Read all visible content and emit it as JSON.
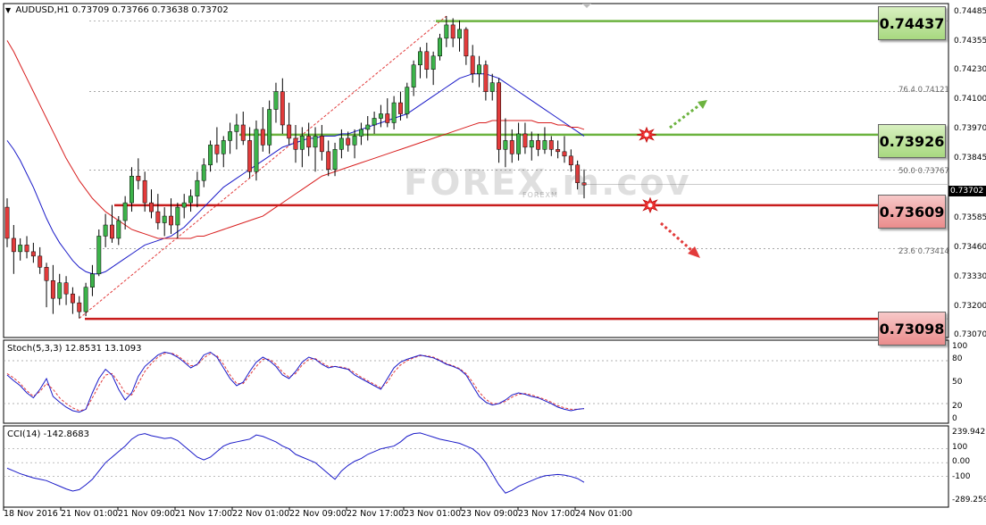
{
  "header": {
    "symbol": "AUDUSD,H1",
    "ohlc": "0.73709 0.73766 0.73638 0.73702"
  },
  "watermark": {
    "text": "FOREX.m.cov",
    "sub": "FOREXM"
  },
  "colors": {
    "bull": "#3cb34a",
    "bear": "#e23b3b",
    "ma_fast": "#1a1ac8",
    "ma_slow": "#d81e1e",
    "resistance": "#6cb33f",
    "support": "#c81c1c",
    "oscillator": "#1a1ac8",
    "signal": "#e23b3b"
  },
  "price_axis": {
    "labels": [
      "0.74485",
      "0.74355",
      "0.74230",
      "0.74100",
      "0.73970",
      "0.73845",
      "0.73715",
      "0.73585",
      "0.73460",
      "0.73330",
      "0.73200",
      "0.73070"
    ],
    "current": "0.73702"
  },
  "levels": {
    "r2": "0.74437",
    "r1": "0.73926",
    "s1": "0.73609",
    "s2": "0.73098"
  },
  "fib_labels": {
    "f764": "76.4  0.74121",
    "f500": "50.0  0.73767",
    "f236": "23.6  0.73414"
  },
  "x_labels": [
    "18 Nov 2016",
    "21 Nov 01:00",
    "21 Nov 09:00",
    "21 Nov 17:00",
    "22 Nov 01:00",
    "22 Nov 09:00",
    "22 Nov 17:00",
    "23 Nov 01:00",
    "23 Nov 09:00",
    "23 Nov 17:00",
    "24 Nov 01:00"
  ],
  "stoch": {
    "label": "Stoch(5,3,3) 12.8531 13.1093",
    "axis": [
      "100",
      "80",
      "50",
      "20",
      "0"
    ]
  },
  "cci": {
    "label": "CCI(14) -142.8683",
    "axis": [
      "239.9421",
      "100",
      "0.00",
      "-100",
      "-289.259"
    ]
  },
  "chart_data": [
    {
      "type": "candlestick",
      "title": "AUDUSD,H1",
      "timeframe": "H1",
      "y_range": [
        0.7303,
        0.745
      ],
      "current_price": 0.73702,
      "candles": [
        [
          0.736,
          0.7364,
          0.7342,
          0.7346
        ],
        [
          0.7346,
          0.7352,
          0.733,
          0.734
        ],
        [
          0.734,
          0.7346,
          0.7336,
          0.7343
        ],
        [
          0.7343,
          0.7347,
          0.7337,
          0.734
        ],
        [
          0.734,
          0.7344,
          0.7335,
          0.7338
        ],
        [
          0.7338,
          0.7342,
          0.733,
          0.7333
        ],
        [
          0.7333,
          0.7335,
          0.7315,
          0.7327
        ],
        [
          0.7327,
          0.7334,
          0.7312,
          0.7319
        ],
        [
          0.7319,
          0.733,
          0.7316,
          0.7326
        ],
        [
          0.7326,
          0.7329,
          0.7316,
          0.7321
        ],
        [
          0.7321,
          0.7324,
          0.7312,
          0.7317
        ],
        [
          0.7317,
          0.732,
          0.731,
          0.7313
        ],
        [
          0.7313,
          0.7326,
          0.7311,
          0.7324
        ],
        [
          0.7324,
          0.7334,
          0.732,
          0.733
        ],
        [
          0.733,
          0.735,
          0.7329,
          0.7347
        ],
        [
          0.7347,
          0.7357,
          0.7342,
          0.7352
        ],
        [
          0.7352,
          0.7361,
          0.7344,
          0.7346
        ],
        [
          0.7346,
          0.7356,
          0.7343,
          0.7354
        ],
        [
          0.7354,
          0.7365,
          0.735,
          0.7362
        ],
        [
          0.7362,
          0.7378,
          0.7358,
          0.7374
        ],
        [
          0.7374,
          0.7382,
          0.7368,
          0.7372
        ],
        [
          0.7372,
          0.7376,
          0.7358,
          0.7362
        ],
        [
          0.7362,
          0.7368,
          0.7355,
          0.7358
        ],
        [
          0.7358,
          0.7366,
          0.735,
          0.7353
        ],
        [
          0.7353,
          0.736,
          0.7347,
          0.7356
        ],
        [
          0.7356,
          0.7364,
          0.7348,
          0.7352
        ],
        [
          0.7352,
          0.7362,
          0.7346,
          0.736
        ],
        [
          0.736,
          0.7366,
          0.7355,
          0.7362
        ],
        [
          0.7362,
          0.7368,
          0.7358,
          0.7365
        ],
        [
          0.7365,
          0.7376,
          0.736,
          0.7372
        ],
        [
          0.7372,
          0.7382,
          0.7369,
          0.7379
        ],
        [
          0.7379,
          0.739,
          0.7376,
          0.7388
        ],
        [
          0.7388,
          0.7396,
          0.738,
          0.7384
        ],
        [
          0.7384,
          0.7392,
          0.7378,
          0.739
        ],
        [
          0.739,
          0.7398,
          0.7384,
          0.7394
        ],
        [
          0.7394,
          0.7402,
          0.7386,
          0.7397
        ],
        [
          0.7397,
          0.7403,
          0.7388,
          0.739
        ],
        [
          0.739,
          0.7396,
          0.7373,
          0.7376
        ],
        [
          0.7376,
          0.7399,
          0.7372,
          0.7395
        ],
        [
          0.7395,
          0.7405,
          0.7385,
          0.7388
        ],
        [
          0.7388,
          0.7408,
          0.7384,
          0.7404
        ],
        [
          0.7404,
          0.7416,
          0.7398,
          0.7412
        ],
        [
          0.7412,
          0.7418,
          0.7393,
          0.7397
        ],
        [
          0.7397,
          0.7407,
          0.7388,
          0.7391
        ],
        [
          0.7391,
          0.7397,
          0.738,
          0.7386
        ],
        [
          0.7386,
          0.7396,
          0.7378,
          0.7392
        ],
        [
          0.7392,
          0.7398,
          0.7383,
          0.7387
        ],
        [
          0.7387,
          0.7396,
          0.7376,
          0.7392
        ],
        [
          0.7392,
          0.7397,
          0.7381,
          0.7385
        ],
        [
          0.7385,
          0.739,
          0.7374,
          0.7377
        ],
        [
          0.7377,
          0.7389,
          0.7374,
          0.7386
        ],
        [
          0.7386,
          0.7395,
          0.7382,
          0.7391
        ],
        [
          0.7391,
          0.7394,
          0.7385,
          0.7388
        ],
        [
          0.7388,
          0.7395,
          0.7382,
          0.7392
        ],
        [
          0.7392,
          0.7398,
          0.7388,
          0.7395
        ],
        [
          0.7395,
          0.7401,
          0.739,
          0.7397
        ],
        [
          0.7397,
          0.7403,
          0.7393,
          0.74
        ],
        [
          0.74,
          0.7406,
          0.7396,
          0.7402
        ],
        [
          0.7402,
          0.7409,
          0.7396,
          0.7398
        ],
        [
          0.7398,
          0.741,
          0.7395,
          0.7407
        ],
        [
          0.7407,
          0.7412,
          0.7399,
          0.7402
        ],
        [
          0.7402,
          0.7416,
          0.74,
          0.7414
        ],
        [
          0.7414,
          0.7426,
          0.741,
          0.7424
        ],
        [
          0.7424,
          0.7432,
          0.7418,
          0.743
        ],
        [
          0.743,
          0.7434,
          0.7418,
          0.7422
        ],
        [
          0.7422,
          0.743,
          0.7415,
          0.7428
        ],
        [
          0.7428,
          0.7438,
          0.7426,
          0.7436
        ],
        [
          0.7436,
          0.7446,
          0.7432,
          0.7442
        ],
        [
          0.7442,
          0.7445,
          0.7432,
          0.7436
        ],
        [
          0.7436,
          0.7444,
          0.743,
          0.744
        ],
        [
          0.744,
          0.7441,
          0.7424,
          0.7428
        ],
        [
          0.7428,
          0.7433,
          0.7416,
          0.742
        ],
        [
          0.742,
          0.7428,
          0.7414,
          0.7424
        ],
        [
          0.7424,
          0.7426,
          0.7408,
          0.7412
        ],
        [
          0.7412,
          0.742,
          0.7408,
          0.7416
        ],
        [
          0.7416,
          0.7418,
          0.738,
          0.7386
        ],
        [
          0.7386,
          0.74,
          0.7378,
          0.739
        ],
        [
          0.739,
          0.7395,
          0.738,
          0.7384
        ],
        [
          0.7384,
          0.7398,
          0.7381,
          0.7393
        ],
        [
          0.7393,
          0.7398,
          0.7384,
          0.7387
        ],
        [
          0.7387,
          0.7394,
          0.7381,
          0.739
        ],
        [
          0.739,
          0.7393,
          0.7383,
          0.7386
        ],
        [
          0.7386,
          0.7396,
          0.7384,
          0.739
        ],
        [
          0.739,
          0.7392,
          0.7383,
          0.7386
        ],
        [
          0.7386,
          0.739,
          0.7382,
          0.7385
        ],
        [
          0.7385,
          0.7392,
          0.738,
          0.7383
        ],
        [
          0.7383,
          0.7386,
          0.7376,
          0.7379
        ],
        [
          0.7379,
          0.7381,
          0.7368,
          0.7371
        ],
        [
          0.7371,
          0.7377,
          0.7364,
          0.737
        ]
      ],
      "ma_blue": [
        0.739,
        0.7386,
        0.7381,
        0.7375,
        0.7369,
        0.7362,
        0.7355,
        0.7349,
        0.7344,
        0.734,
        0.7336,
        0.7333,
        0.7331,
        0.733,
        0.733,
        0.7331,
        0.7333,
        0.7335,
        0.7337,
        0.7339,
        0.7341,
        0.7343,
        0.7344,
        0.7345,
        0.7346,
        0.7347,
        0.7349,
        0.7351,
        0.7354,
        0.7357,
        0.736,
        0.7363,
        0.7366,
        0.7369,
        0.7371,
        0.7373,
        0.7375,
        0.7377,
        0.7379,
        0.7381,
        0.7383,
        0.7385,
        0.7387,
        0.7388,
        0.7389,
        0.739,
        0.7391,
        0.7391,
        0.7392,
        0.7392,
        0.7392,
        0.7393,
        0.7393,
        0.7394,
        0.7395,
        0.7396,
        0.7397,
        0.7398,
        0.7399,
        0.74,
        0.7401,
        0.7402,
        0.7404,
        0.7406,
        0.7408,
        0.741,
        0.7412,
        0.7414,
        0.7416,
        0.7418,
        0.7419,
        0.742,
        0.742,
        0.742,
        0.7419,
        0.7418,
        0.7416,
        0.7414,
        0.7412,
        0.741,
        0.7408,
        0.7406,
        0.7404,
        0.7402,
        0.74,
        0.7398,
        0.7396,
        0.7394,
        0.7392
      ],
      "ma_red": [
        0.7435,
        0.743,
        0.7424,
        0.7418,
        0.7412,
        0.7406,
        0.74,
        0.7394,
        0.7388,
        0.7382,
        0.7377,
        0.7372,
        0.7368,
        0.7364,
        0.7361,
        0.7358,
        0.7356,
        0.7354,
        0.7352,
        0.735,
        0.7349,
        0.7348,
        0.7347,
        0.7346,
        0.7346,
        0.7346,
        0.7346,
        0.7346,
        0.7346,
        0.7347,
        0.7347,
        0.7348,
        0.7349,
        0.735,
        0.7351,
        0.7352,
        0.7353,
        0.7354,
        0.7355,
        0.7356,
        0.7358,
        0.736,
        0.7362,
        0.7364,
        0.7366,
        0.7368,
        0.737,
        0.7372,
        0.7374,
        0.7375,
        0.7376,
        0.7377,
        0.7378,
        0.7379,
        0.738,
        0.7381,
        0.7382,
        0.7383,
        0.7384,
        0.7385,
        0.7386,
        0.7387,
        0.7388,
        0.7389,
        0.739,
        0.7391,
        0.7392,
        0.7393,
        0.7394,
        0.7395,
        0.7396,
        0.7397,
        0.7398,
        0.7398,
        0.7399,
        0.7399,
        0.7399,
        0.7399,
        0.7399,
        0.7399,
        0.7399,
        0.7398,
        0.7398,
        0.7398,
        0.7397,
        0.7397,
        0.7396,
        0.7396,
        0.7395
      ],
      "levels": [
        0.74437,
        0.73926,
        0.73609,
        0.73098
      ],
      "fibonacci": [
        {
          "ratio": 76.4,
          "price": 0.74121
        },
        {
          "ratio": 50.0,
          "price": 0.73767
        },
        {
          "ratio": 23.6,
          "price": 0.73414
        }
      ]
    },
    {
      "type": "line",
      "title": "Stoch(5,3,3) 12.8531 13.1093",
      "y_range": [
        0,
        100
      ],
      "levels": [
        80,
        20
      ],
      "series": [
        {
          "name": "main",
          "values": [
            60,
            52,
            45,
            35,
            28,
            40,
            55,
            30,
            22,
            15,
            10,
            8,
            12,
            35,
            55,
            68,
            60,
            40,
            25,
            35,
            58,
            72,
            80,
            88,
            92,
            90,
            85,
            78,
            70,
            75,
            88,
            92,
            85,
            70,
            55,
            45,
            50,
            65,
            78,
            85,
            80,
            72,
            60,
            55,
            65,
            78,
            85,
            82,
            75,
            70,
            72,
            70,
            68,
            60,
            55,
            50,
            45,
            40,
            55,
            70,
            78,
            82,
            85,
            88,
            86,
            84,
            80,
            75,
            72,
            68,
            60,
            45,
            30,
            22,
            18,
            20,
            25,
            32,
            35,
            33,
            30,
            28,
            24,
            20,
            15,
            12,
            10,
            12,
            13
          ]
        },
        {
          "name": "signal",
          "values": [
            62,
            56,
            48,
            38,
            30,
            37,
            48,
            40,
            28,
            20,
            14,
            10,
            12,
            28,
            45,
            60,
            62,
            50,
            35,
            32,
            48,
            65,
            76,
            85,
            90,
            91,
            87,
            80,
            73,
            74,
            84,
            90,
            87,
            75,
            60,
            48,
            48,
            60,
            72,
            82,
            82,
            75,
            64,
            57,
            62,
            74,
            82,
            83,
            77,
            72,
            72,
            71,
            69,
            63,
            57,
            52,
            47,
            42,
            50,
            64,
            74,
            80,
            84,
            87,
            87,
            85,
            81,
            76,
            73,
            69,
            62,
            50,
            36,
            26,
            20,
            20,
            23,
            29,
            33,
            34,
            32,
            29,
            26,
            22,
            17,
            14,
            12,
            12,
            13
          ]
        }
      ]
    },
    {
      "type": "line",
      "title": "CCI(14) -142.8683",
      "y_range": [
        -289.259,
        239.9421
      ],
      "series": [
        {
          "name": "CCI",
          "values": [
            -40,
            -60,
            -80,
            -95,
            -110,
            -120,
            -130,
            -150,
            -170,
            -190,
            -205,
            -195,
            -160,
            -120,
            -60,
            0,
            40,
            80,
            120,
            170,
            200,
            210,
            195,
            185,
            175,
            180,
            160,
            120,
            80,
            40,
            20,
            40,
            80,
            120,
            140,
            150,
            160,
            170,
            200,
            190,
            170,
            150,
            120,
            100,
            60,
            40,
            20,
            0,
            -40,
            -80,
            -120,
            -60,
            -20,
            10,
            30,
            60,
            80,
            100,
            110,
            120,
            150,
            190,
            210,
            215,
            200,
            185,
            170,
            160,
            150,
            140,
            120,
            100,
            60,
            0,
            -80,
            -160,
            -220,
            -200,
            -170,
            -150,
            -130,
            -110,
            -95,
            -90,
            -85,
            -90,
            -100,
            -115,
            -142
          ]
        }
      ]
    }
  ]
}
